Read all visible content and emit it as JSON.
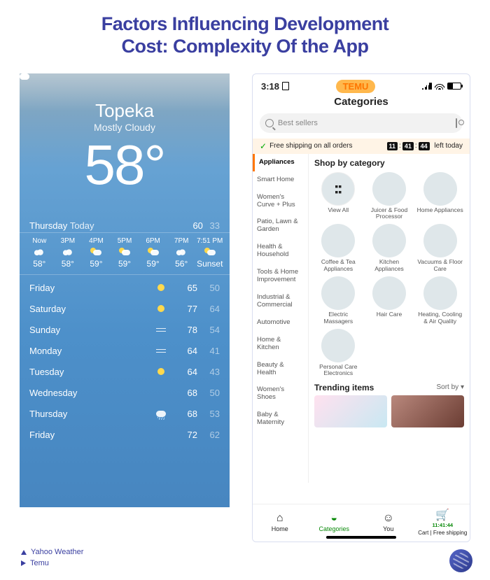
{
  "title_l1": "Factors Influencing Development",
  "title_l2": "Cost: Complexity Of the App",
  "captions": {
    "a": "Yahoo Weather",
    "b": "Temu"
  },
  "weather": {
    "city": "Topeka",
    "condition": "Mostly Cloudy",
    "temp": "58°",
    "today": {
      "label": "Thursday",
      "sub": "Today",
      "hi": "60",
      "lo": "33"
    },
    "hours": [
      {
        "h": "Now",
        "icon": "cloud-i",
        "t": "58°"
      },
      {
        "h": "3PM",
        "icon": "cloud-i",
        "t": "58°"
      },
      {
        "h": "4PM",
        "icon": "part-i",
        "t": "59°"
      },
      {
        "h": "5PM",
        "icon": "part-i",
        "t": "59°"
      },
      {
        "h": "6PM",
        "icon": "part-i",
        "t": "59°"
      },
      {
        "h": "7PM",
        "icon": "cloud-i",
        "t": "56°"
      },
      {
        "h": "7:51 PM",
        "icon": "part-i",
        "t": "Sunset"
      }
    ],
    "daily": [
      {
        "d": "Friday",
        "icon": "sun",
        "hi": "65",
        "lo": "50"
      },
      {
        "d": "Saturday",
        "icon": "sun",
        "hi": "77",
        "lo": "64"
      },
      {
        "d": "Sunday",
        "icon": "wind",
        "hi": "78",
        "lo": "54"
      },
      {
        "d": "Monday",
        "icon": "wind",
        "hi": "64",
        "lo": "41"
      },
      {
        "d": "Tuesday",
        "icon": "sun",
        "hi": "64",
        "lo": "43"
      },
      {
        "d": "Wednesday",
        "icon": "cloud",
        "hi": "68",
        "lo": "50"
      },
      {
        "d": "Thursday",
        "icon": "rain",
        "hi": "68",
        "lo": "53"
      },
      {
        "d": "Friday",
        "icon": "cloud",
        "hi": "72",
        "lo": "62"
      }
    ]
  },
  "temu": {
    "time": "3:18",
    "brand": "TEMU",
    "cats_title": "Categories",
    "search_placeholder": "Best sellers",
    "shipping": {
      "text": "Free shipping on all orders",
      "h": "11",
      "m": "41",
      "s": "44",
      "suffix": "left today"
    },
    "side": [
      "Appliances",
      "Smart Home",
      "Women's Curve + Plus",
      "Patio, Lawn & Garden",
      "Health & Household",
      "Tools & Home Improvement",
      "Industrial & Commercial",
      "Automotive",
      "Home & Kitchen",
      "Beauty & Health",
      "Women's Shoes",
      "Baby & Maternity"
    ],
    "heading": "Shop by category",
    "grid": [
      {
        "lbl": "View All",
        "t": "viewall"
      },
      {
        "lbl": "Juicer & Food Processor",
        "t": "c1"
      },
      {
        "lbl": "Home Appliances",
        "t": "c2"
      },
      {
        "lbl": "Coffee & Tea Appliances",
        "t": "c3"
      },
      {
        "lbl": "Kitchen Appliances",
        "t": "c4"
      },
      {
        "lbl": "Vacuums & Floor Care",
        "t": "c5"
      },
      {
        "lbl": "Electric Massagers",
        "t": "c6"
      },
      {
        "lbl": "Hair Care",
        "t": "c7"
      },
      {
        "lbl": "Heating, Cooling & Air Quality",
        "t": "c8"
      },
      {
        "lbl": "Personal Care Electronics",
        "t": "c9"
      }
    ],
    "trending": "Trending items",
    "sort": "Sort by",
    "tabs": {
      "home": "Home",
      "categories": "Categories",
      "you": "You",
      "cart_label": "Cart | Free shipping",
      "cart_timer": "11:41:44"
    }
  }
}
